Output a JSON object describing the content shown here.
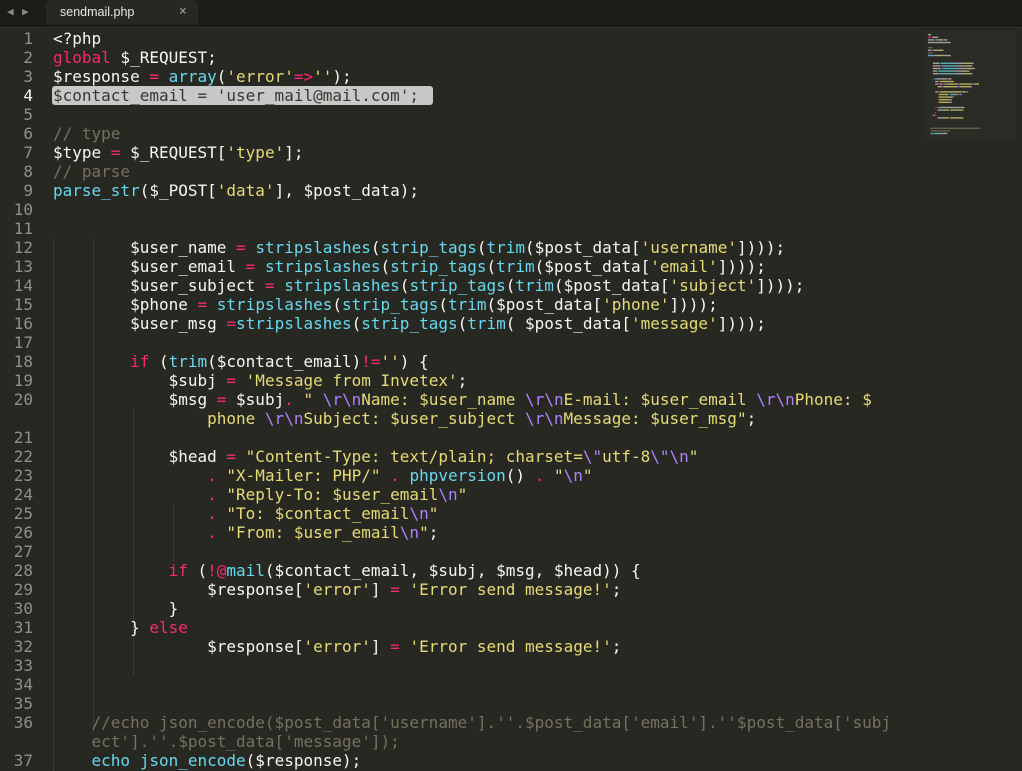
{
  "tabbar": {
    "back_arrow": "◀",
    "forward_arrow": "▶",
    "file_tab": "sendmail.php",
    "close_glyph": "×"
  },
  "colors": {
    "background": "#272822",
    "keyword": "#f92672",
    "string": "#e6db74",
    "function": "#66d9ef",
    "comment": "#75715e",
    "escape": "#ae81ff",
    "text": "#f8f8f2"
  },
  "lines": [
    {
      "n": "1",
      "tokens": [
        [
          "",
          "<?php"
        ]
      ]
    },
    {
      "n": "2",
      "tokens": [
        [
          "kw",
          "global"
        ],
        [
          "",
          " $_REQUEST;"
        ]
      ]
    },
    {
      "n": "3",
      "tokens": [
        [
          "",
          "$response "
        ],
        [
          "op",
          "="
        ],
        [
          "",
          " "
        ],
        [
          "fn",
          "array"
        ],
        [
          "",
          "("
        ],
        [
          "str",
          "'error'"
        ],
        [
          "op",
          "=>"
        ],
        [
          "str",
          "''"
        ],
        [
          "",
          "); "
        ]
      ]
    },
    {
      "n": "4",
      "tokens": [
        [
          "",
          "$contact_email = 'user_mail@mail.com';"
        ]
      ]
    },
    {
      "n": "5",
      "tokens": []
    },
    {
      "n": "6",
      "tokens": [
        [
          "cm",
          "// type"
        ]
      ]
    },
    {
      "n": "7",
      "tokens": [
        [
          "",
          "$type "
        ],
        [
          "op",
          "="
        ],
        [
          "",
          " $_REQUEST["
        ],
        [
          "str",
          "'type'"
        ],
        [
          "",
          "];"
        ]
      ]
    },
    {
      "n": "8",
      "tokens": [
        [
          "cm",
          "// parse"
        ]
      ]
    },
    {
      "n": "9",
      "tokens": [
        [
          "fn",
          "parse_str"
        ],
        [
          "",
          "($_POST["
        ],
        [
          "str",
          "'data'"
        ],
        [
          "",
          "], $post_data);"
        ]
      ]
    },
    {
      "n": "10",
      "tokens": []
    },
    {
      "n": "11",
      "tokens": []
    },
    {
      "n": "12",
      "tokens": [
        [
          "",
          "        $user_name "
        ],
        [
          "op",
          "="
        ],
        [
          "",
          " "
        ],
        [
          "fn",
          "stripslashes"
        ],
        [
          "",
          "("
        ],
        [
          "fn",
          "strip_tags"
        ],
        [
          "",
          "("
        ],
        [
          "fn",
          "trim"
        ],
        [
          "",
          "($post_data["
        ],
        [
          "str",
          "'username'"
        ],
        [
          "",
          "])));"
        ]
      ]
    },
    {
      "n": "13",
      "tokens": [
        [
          "",
          "        $user_email "
        ],
        [
          "op",
          "="
        ],
        [
          "",
          " "
        ],
        [
          "fn",
          "stripslashes"
        ],
        [
          "",
          "("
        ],
        [
          "fn",
          "strip_tags"
        ],
        [
          "",
          "("
        ],
        [
          "fn",
          "trim"
        ],
        [
          "",
          "($post_data["
        ],
        [
          "str",
          "'email'"
        ],
        [
          "",
          "])));"
        ]
      ]
    },
    {
      "n": "14",
      "tokens": [
        [
          "",
          "        $user_subject "
        ],
        [
          "op",
          "="
        ],
        [
          "",
          " "
        ],
        [
          "fn",
          "stripslashes"
        ],
        [
          "",
          "("
        ],
        [
          "fn",
          "strip_tags"
        ],
        [
          "",
          "("
        ],
        [
          "fn",
          "trim"
        ],
        [
          "",
          "($post_data["
        ],
        [
          "str",
          "'subject'"
        ],
        [
          "",
          "])));"
        ]
      ]
    },
    {
      "n": "15",
      "tokens": [
        [
          "",
          "        $phone "
        ],
        [
          "op",
          "="
        ],
        [
          "",
          " "
        ],
        [
          "fn",
          "stripslashes"
        ],
        [
          "",
          "("
        ],
        [
          "fn",
          "strip_tags"
        ],
        [
          "",
          "("
        ],
        [
          "fn",
          "trim"
        ],
        [
          "",
          "($post_data["
        ],
        [
          "str",
          "'phone'"
        ],
        [
          "",
          "])));"
        ]
      ]
    },
    {
      "n": "16",
      "tokens": [
        [
          "",
          "        $user_msg "
        ],
        [
          "op",
          "="
        ],
        [
          "fn",
          "stripslashes"
        ],
        [
          "",
          "("
        ],
        [
          "fn",
          "strip_tags"
        ],
        [
          "",
          "("
        ],
        [
          "fn",
          "trim"
        ],
        [
          "",
          "( $post_data["
        ],
        [
          "str",
          "'message'"
        ],
        [
          "",
          "])));"
        ]
      ]
    },
    {
      "n": "17",
      "tokens": []
    },
    {
      "n": "18",
      "tokens": [
        [
          "",
          "        "
        ],
        [
          "kw",
          "if"
        ],
        [
          "",
          " ("
        ],
        [
          "fn",
          "trim"
        ],
        [
          "",
          "($contact_email)"
        ],
        [
          "op",
          "!="
        ],
        [
          "str",
          "''"
        ],
        [
          "",
          ") {"
        ]
      ]
    },
    {
      "n": "19",
      "tokens": [
        [
          "",
          "            $subj "
        ],
        [
          "op",
          "="
        ],
        [
          "",
          " "
        ],
        [
          "str",
          "'Message from Invetex'"
        ],
        [
          "",
          ";"
        ]
      ]
    },
    {
      "n": "20",
      "tokens": [
        [
          "",
          "            $msg "
        ],
        [
          "op",
          "="
        ],
        [
          "",
          " $subj"
        ],
        [
          "op",
          "."
        ],
        [
          "",
          " "
        ],
        [
          "str",
          "\" "
        ],
        [
          "esc",
          "\\r\\n"
        ],
        [
          "str",
          "Name: $user_name "
        ],
        [
          "esc",
          "\\r\\n"
        ],
        [
          "str",
          "E-mail: $user_email "
        ],
        [
          "esc",
          "\\r\\n"
        ],
        [
          "str",
          "Phone: $"
        ]
      ]
    },
    {
      "n": "",
      "tokens": [
        [
          "str",
          "                phone "
        ],
        [
          "esc",
          "\\r\\n"
        ],
        [
          "str",
          "Subject: $user_subject "
        ],
        [
          "esc",
          "\\r\\n"
        ],
        [
          "str",
          "Message: $user_msg\""
        ],
        [
          "",
          ";"
        ]
      ]
    },
    {
      "n": "21",
      "tokens": []
    },
    {
      "n": "22",
      "tokens": [
        [
          "",
          "            $head "
        ],
        [
          "op",
          "="
        ],
        [
          "",
          " "
        ],
        [
          "str",
          "\"Content-Type: text/plain; charset="
        ],
        [
          "esc",
          "\\\""
        ],
        [
          "str",
          "utf-8"
        ],
        [
          "esc",
          "\\\""
        ],
        [
          "esc",
          "\\n"
        ],
        [
          "str",
          "\""
        ]
      ]
    },
    {
      "n": "23",
      "tokens": [
        [
          "",
          "                "
        ],
        [
          "op",
          "."
        ],
        [
          "",
          " "
        ],
        [
          "str",
          "\"X-Mailer: PHP/\""
        ],
        [
          "",
          " "
        ],
        [
          "op",
          "."
        ],
        [
          "",
          " "
        ],
        [
          "fn",
          "phpversion"
        ],
        [
          "",
          "() "
        ],
        [
          "op",
          "."
        ],
        [
          "",
          " "
        ],
        [
          "str",
          "\""
        ],
        [
          "esc",
          "\\n"
        ],
        [
          "str",
          "\""
        ]
      ]
    },
    {
      "n": "24",
      "tokens": [
        [
          "",
          "                "
        ],
        [
          "op",
          "."
        ],
        [
          "",
          " "
        ],
        [
          "str",
          "\"Reply-To: $user_email"
        ],
        [
          "esc",
          "\\n"
        ],
        [
          "str",
          "\""
        ]
      ]
    },
    {
      "n": "25",
      "tokens": [
        [
          "",
          "                "
        ],
        [
          "op",
          "."
        ],
        [
          "",
          " "
        ],
        [
          "str",
          "\"To: $contact_email"
        ],
        [
          "esc",
          "\\n"
        ],
        [
          "str",
          "\""
        ]
      ]
    },
    {
      "n": "26",
      "tokens": [
        [
          "",
          "                "
        ],
        [
          "op",
          "."
        ],
        [
          "",
          " "
        ],
        [
          "str",
          "\"From: $user_email"
        ],
        [
          "esc",
          "\\n"
        ],
        [
          "str",
          "\""
        ],
        [
          "",
          ";"
        ]
      ]
    },
    {
      "n": "27",
      "tokens": []
    },
    {
      "n": "28",
      "tokens": [
        [
          "",
          "            "
        ],
        [
          "kw",
          "if"
        ],
        [
          "",
          " ("
        ],
        [
          "op",
          "!@"
        ],
        [
          "fn",
          "mail"
        ],
        [
          "",
          "($contact_email, $subj, $msg, $head)) {"
        ]
      ]
    },
    {
      "n": "29",
      "tokens": [
        [
          "",
          "                $response["
        ],
        [
          "str",
          "'error'"
        ],
        [
          "",
          "] "
        ],
        [
          "op",
          "="
        ],
        [
          "",
          " "
        ],
        [
          "str",
          "'Error send message!'"
        ],
        [
          "",
          ";"
        ]
      ]
    },
    {
      "n": "30",
      "tokens": [
        [
          "",
          "            }"
        ]
      ]
    },
    {
      "n": "31",
      "tokens": [
        [
          "",
          "        } "
        ],
        [
          "kw",
          "else"
        ]
      ]
    },
    {
      "n": "32",
      "tokens": [
        [
          "",
          "                $response["
        ],
        [
          "str",
          "'error'"
        ],
        [
          "",
          "] "
        ],
        [
          "op",
          "="
        ],
        [
          "",
          " "
        ],
        [
          "str",
          "'Error send message!'"
        ],
        [
          "",
          ";"
        ]
      ]
    },
    {
      "n": "33",
      "tokens": []
    },
    {
      "n": "34",
      "tokens": []
    },
    {
      "n": "35",
      "tokens": []
    },
    {
      "n": "36",
      "tokens": [
        [
          "cm",
          "    //echo json_encode($post_data['username'].''.$post_data['email'].''$post_data['subj"
        ]
      ]
    },
    {
      "n": "",
      "tokens": [
        [
          "cm",
          "    ect'].''.$post_data['message']);"
        ]
      ]
    },
    {
      "n": "37",
      "tokens": [
        [
          "",
          "    "
        ],
        [
          "fn",
          "echo"
        ],
        [
          "",
          " "
        ],
        [
          "fn",
          "json_encode"
        ],
        [
          "",
          "($response);"
        ]
      ]
    }
  ]
}
